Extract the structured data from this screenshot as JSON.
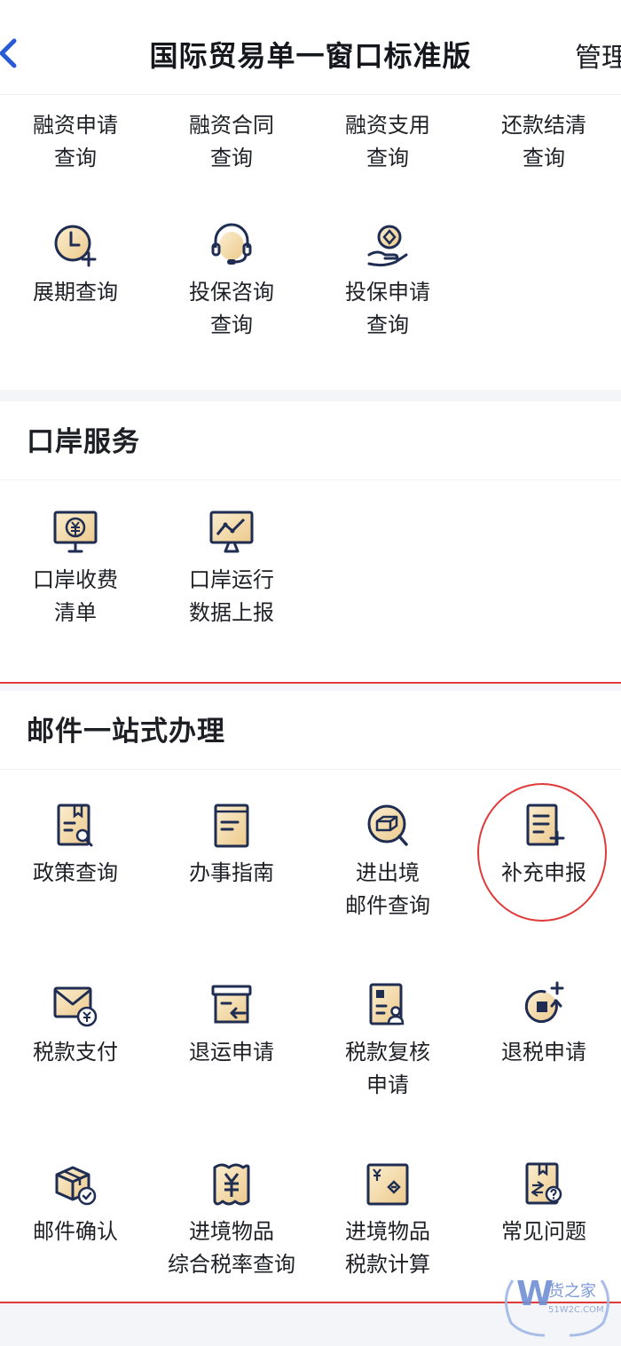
{
  "header": {
    "title": "国际贸易单一窗口标准版",
    "manage": "管理"
  },
  "finance_items": [
    {
      "l1": "融资申请",
      "l2": "查询"
    },
    {
      "l1": "融资合同",
      "l2": "查询"
    },
    {
      "l1": "融资支用",
      "l2": "查询"
    },
    {
      "l1": "还款结清",
      "l2": "查询"
    },
    {
      "l1": "展期查询",
      "l2": ""
    },
    {
      "l1": "投保咨询",
      "l2": "查询"
    },
    {
      "l1": "投保申请",
      "l2": "查询"
    }
  ],
  "port": {
    "title": "口岸服务",
    "items": [
      {
        "l1": "口岸收费",
        "l2": "清单"
      },
      {
        "l1": "口岸运行",
        "l2": "数据上报"
      }
    ]
  },
  "mail": {
    "title": "邮件一站式办理",
    "items": [
      {
        "l1": "政策查询",
        "l2": ""
      },
      {
        "l1": "办事指南",
        "l2": ""
      },
      {
        "l1": "进出境",
        "l2": "邮件查询"
      },
      {
        "l1": "补充申报",
        "l2": ""
      },
      {
        "l1": "税款支付",
        "l2": ""
      },
      {
        "l1": "退运申请",
        "l2": ""
      },
      {
        "l1": "税款复核",
        "l2": "申请"
      },
      {
        "l1": "退税申请",
        "l2": ""
      },
      {
        "l1": "邮件确认",
        "l2": ""
      },
      {
        "l1": "进境物品",
        "l2": "综合税率查询"
      },
      {
        "l1": "进境物品",
        "l2": "税款计算"
      },
      {
        "l1": "常见问题",
        "l2": ""
      }
    ]
  },
  "watermark": {
    "brand": "货之家",
    "domain": "51W2C.COM"
  },
  "colors": {
    "navy": "#1f2d52",
    "gold": "#f2d9a6",
    "annotation_red": "#e03a3a",
    "back_blue": "#2a5bd7"
  }
}
